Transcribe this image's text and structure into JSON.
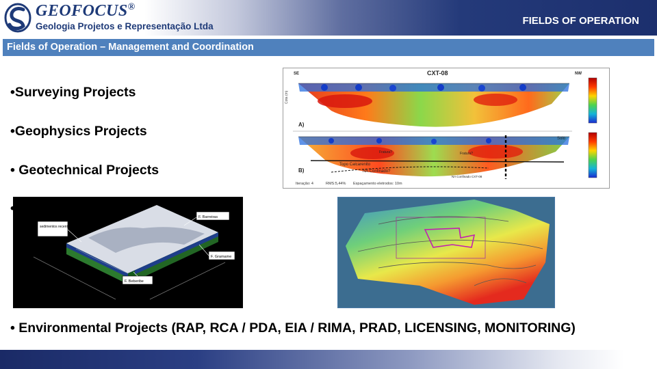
{
  "header": {
    "brand": "GEOFOCUS",
    "registered": "®",
    "subtitle": "Geologia Projetos e Representação Ltda",
    "section": "FIELDS OF OPERATION"
  },
  "title_bar": "Fields of Operation – Management and Coordination",
  "bullets": [
    "•Surveying Projects",
    "•Geophysics Projects",
    "• Geotechnical Projects",
    "•",
    "• Environmental Projects (RAP, RCA / PDA, EIA / RIMA, PRAD, LICENSING, MONITORING)"
  ],
  "figure_resistivity": {
    "title": "CXT-08",
    "left_dir": "SE",
    "right_dir": "NW",
    "panel_a": "A)",
    "panel_b": "B)",
    "axis_label": "Cota (m)",
    "labels": [
      "Solo",
      "Topo Calcarenito",
      "Fratura?",
      "Fratura?",
      "NA Confinado?",
      "NA Confinado CXT-08"
    ],
    "footer_iter": "Iteração: 4",
    "footer_rms": "RMS:5,44%",
    "footer_spacing": "Espaçamento eletrodos: 10m"
  },
  "figure_3d": {
    "labels": [
      "sedimentos recentes",
      "F. Barreiras",
      "F. Gramame",
      "F. Beberibe"
    ]
  },
  "colors": {
    "brand": "#1e3a78",
    "title_bar": "#4f81bd",
    "header_dark": "#1c2f6d"
  }
}
